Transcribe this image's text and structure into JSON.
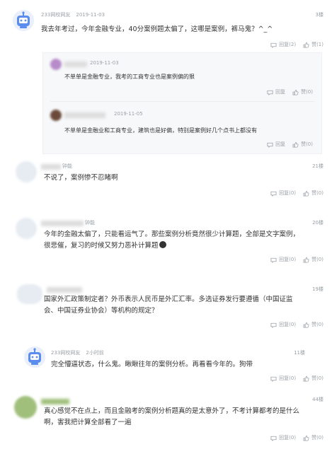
{
  "comments": [
    {
      "author": "233网校网友",
      "time": "2019-11-03",
      "floor": "3楼",
      "text": "我去年考过，今年金融专业，40分案例题太偏了，这哪是案例，裤马鬼？^_^",
      "reply_label": "回复(2)",
      "like_label": "赞(1)",
      "replies": [
        {
          "time": "2019-11-03",
          "text": "不单单是金融专业，我考的工商专业也是案例偏的狠",
          "reply_label": "回复",
          "like_label": "赞(0)"
        },
        {
          "time": "2019-11-05",
          "text": "不单单是金融业和工商专业，建筑也是好偏，特别是案例好几个点书上都没有",
          "reply_label": "回复",
          "like_label": "赞(0)"
        }
      ]
    },
    {
      "author": "钟能",
      "floor": "21楼",
      "text": "不说了，案例惨不忍睹啊",
      "reply_label": "回复(0)",
      "like_label": "赞(0)"
    },
    {
      "author": "钟能",
      "floor": "20楼",
      "text_line1": "今年的金融太偏了，只能看运气了。那些案例分析竟然很少计算题，全部是文字案例，",
      "text_line2": "很悲催，复习的时候又努力恶补计算题",
      "reply_label": "回复(0)",
      "like_label": "赞(0)"
    },
    {
      "floor": "19楼",
      "text_line1": "国家外汇政策制定者？外币表示人民币是外汇汇率。多选证券发行要遵循（中国证监",
      "text_line2": "会、中国证券业协会）等机构的规定？",
      "reply_label": "回复(0)",
      "like_label": "赞(0)"
    },
    {
      "author": "233网校网友",
      "time": "2小时前",
      "floor": "11楼",
      "text": "完全懵逼状态，什么鬼。瞅瞅往年的案例分析。再看看今年的。狗带",
      "reply_label": "回复(0)",
      "like_label": "赞(0)"
    },
    {
      "floor": "44楼",
      "text_line1": "真心感觉不在点上，而且金融考的案例分析题真的是太意外了，不考计算都考的是什么",
      "text_line2": "啊，害我把计算全部看了一遍",
      "reply_label": "回复(0)",
      "like_label": "赞(0)"
    }
  ],
  "icons": {
    "reply": "comment-icon",
    "like": "thumbs-up-icon"
  },
  "colors": {
    "meta": "#9aa0a6",
    "text": "#333333",
    "reply_bg": "#f7f8fa",
    "robot_avatar": "#5b8def"
  }
}
